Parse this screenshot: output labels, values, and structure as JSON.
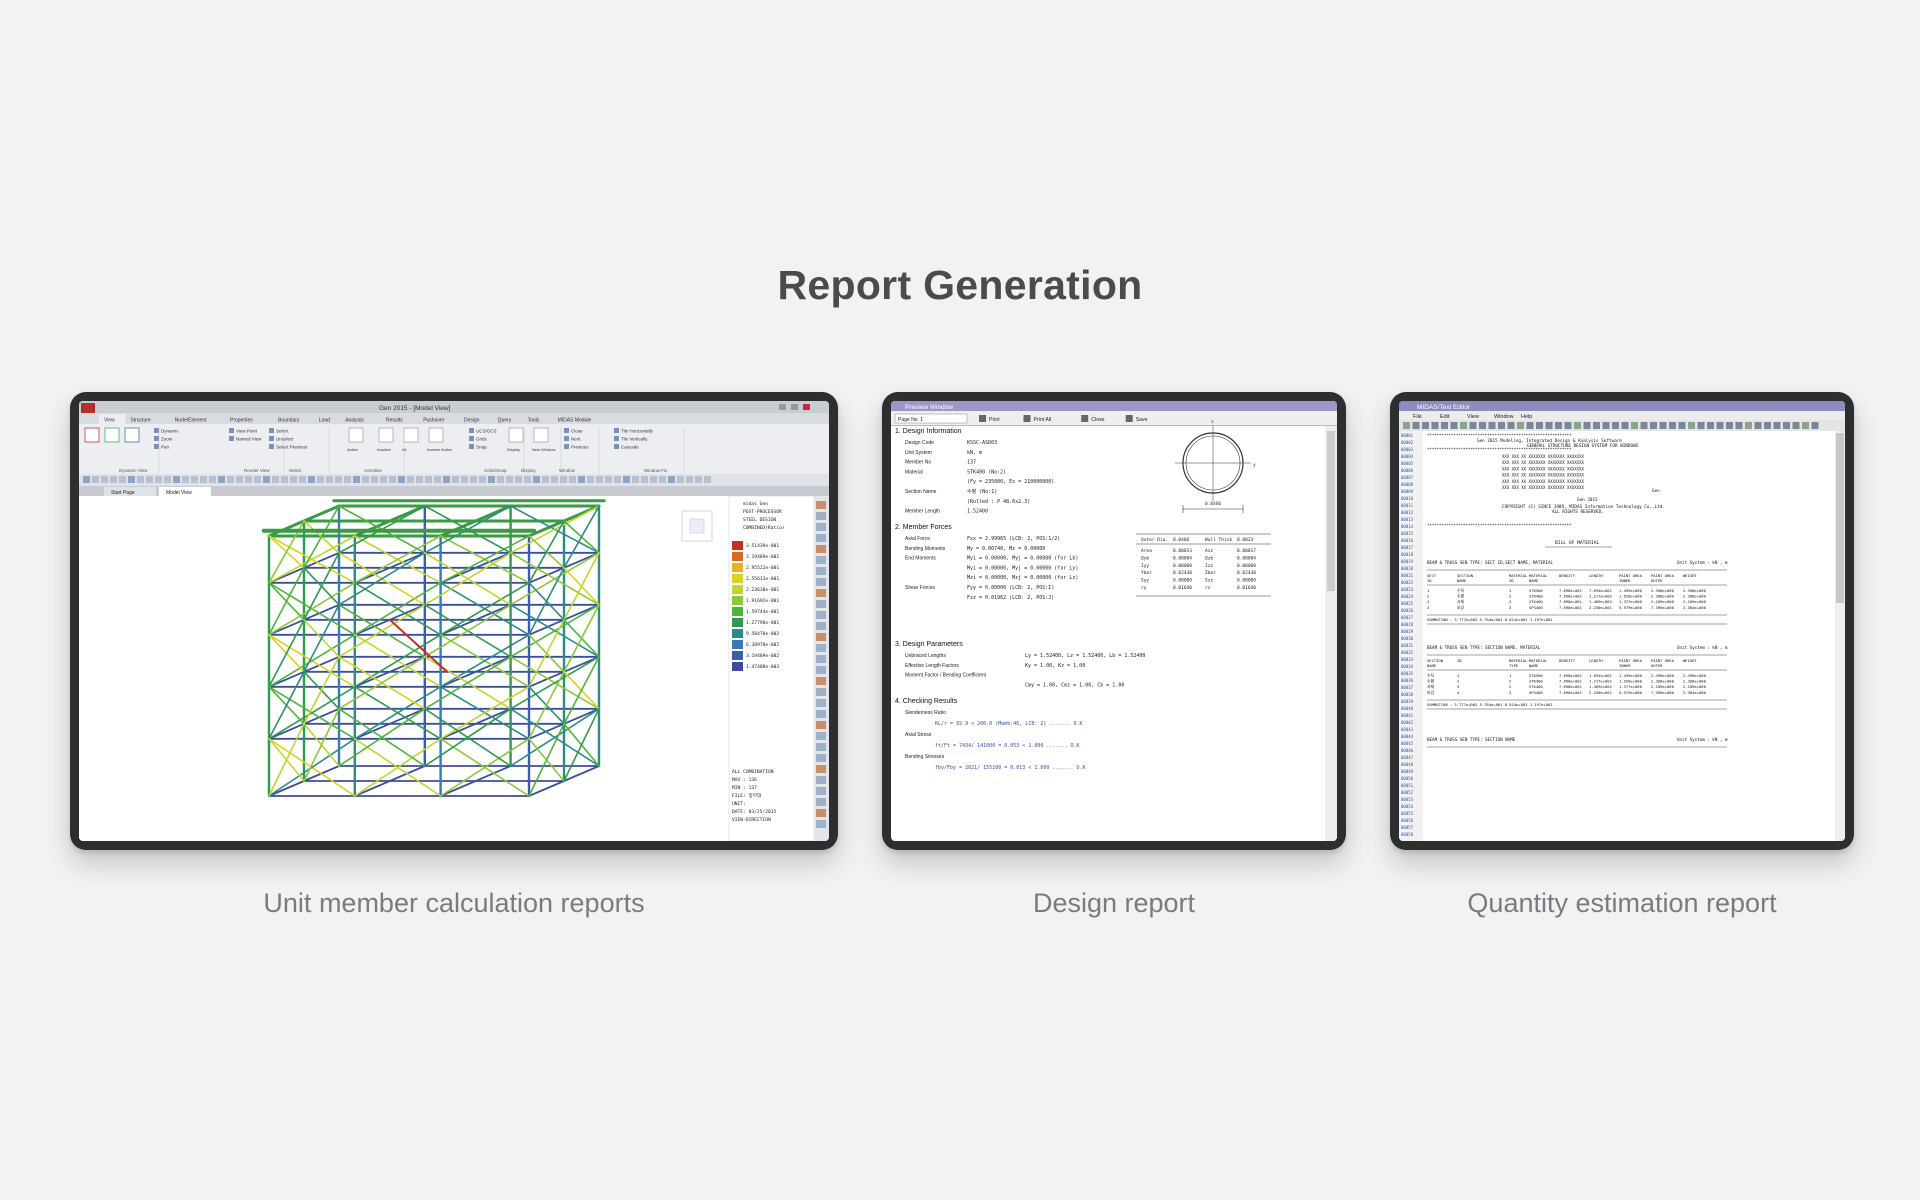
{
  "page": {
    "title": "Report Generation",
    "background": "#f1f2f4",
    "title_color": "#4a4b4d",
    "caption_color": "#7a7b7e",
    "bezel_color": "#2d2e30"
  },
  "cards": [
    {
      "caption": "Unit member calculation reports",
      "screen": {
        "window_title": "Gen 2015 - [Model View]",
        "ribbon_tabs": [
          "View",
          "Structure",
          "Node/Element",
          "Properties",
          "Boundary",
          "Load",
          "Analysis",
          "Results",
          "Pushover",
          "Design",
          "Query",
          "Tools",
          "MIDAS Module"
        ],
        "ribbon_groups": [
          "Dynamic View",
          "Render View",
          "Select",
          "Activities",
          "Grids/Snap",
          "Display",
          "Window",
          "Window Fix"
        ],
        "tool_labels": [
          "Dynamic",
          "Zoom",
          "Pan",
          "View Point",
          "Named View",
          "Select",
          "Unselect",
          "Select Previous",
          "Active",
          "Inactive",
          "All",
          "Inverse Active",
          "UCS/GCS",
          "Grids",
          "Snap",
          "Display",
          "New Window",
          "Close",
          "Next",
          "Previous",
          "Tile Horizontally",
          "Tile Vertically",
          "Cascade"
        ],
        "doc_tabs": [
          "Start Page",
          "Model View"
        ],
        "legend": {
          "header": [
            "midas Gen",
            "POST-PROCESSOR",
            "STEEL DESIGN",
            "COMBINED(Ratio)"
          ],
          "values": [
            "3.51439e-001",
            "3.19489e-001",
            "2.95522e-001",
            "2.55613e-001",
            "2.23630e-001",
            "1.91692e-001",
            "1.59744e-001",
            "1.27796e-001",
            "9.58470e-002",
            "6.38978e-002",
            "3.19489e-002",
            "1.47400e-003"
          ],
          "colors": [
            "#c33126",
            "#d9691e",
            "#e8b222",
            "#d7d320",
            "#bfd72a",
            "#8bc937",
            "#4fb43d",
            "#2e9a4f",
            "#2b8c86",
            "#3a7ab4",
            "#3d5dac",
            "#3e4a9c"
          ],
          "footer": [
            "ALL COMBINATION",
            "MAX : 136",
            "MIN : 137",
            "FILE: 동부대",
            "UNIT:",
            "DATE: 03/25/2015",
            "VIEW-DIRECTION"
          ]
        }
      }
    },
    {
      "caption": "Design report",
      "screen": {
        "window_title": "Preview Window",
        "toolbar": [
          "Page No. 1",
          "Print",
          "Print All",
          "Close",
          "Save"
        ],
        "sections": [
          {
            "heading": "1. Design Information",
            "lines": [
              [
                "Design Code",
                "KSSC-ASD03"
              ],
              [
                "Unit System",
                "kN, m"
              ],
              [
                "Member No",
                "137"
              ],
              [
                "Material",
                "STK400 (No:2)"
              ],
              [
                "",
                "(Fy = 235000, Es = 210000000)"
              ],
              [
                "Section Name",
                "수평 (No:1)"
              ],
              [
                "",
                "(Rolled : P 48.6x2.3)"
              ],
              [
                "Member Length",
                "1.52400"
              ]
            ]
          },
          {
            "heading": "2. Member Forces",
            "lines": [
              [
                "Axial Force",
                "Fxx = 2.99965  (LCB:   2,  POS:1/2)"
              ],
              [
                "Bending Moments",
                "My  = 0.00740,  Mz  = 0.00000"
              ],
              [
                "End Moments",
                "Myi = 0.00000,  Myj = 0.00000  (for Lb)"
              ],
              [
                "",
                "Myi = 0.00000,  Myj = 0.00000  (for Ly)"
              ],
              [
                "",
                "Mzi = 0.00000,  Mzj = 0.00000  (for Lz)"
              ],
              [
                "Shear Forces",
                "Fyy  = 0.00000  (LCB:   2,  POS:I)"
              ],
              [
                "",
                "Fzz  = 0.01962  (LCB:   2,  POS:J)"
              ]
            ]
          },
          {
            "heading": "3. Design Parameters",
            "lines": [
              [
                "Unbraced Lengths",
                "Ly  = 1.52400,     Lz  = 1.52400,     Lb  = 1.52400"
              ],
              [
                "Effective Length Factors",
                "Ky  =  1.00,  Kz  =  1.00"
              ],
              [
                "Moment Factor / Bending Coefficient",
                ""
              ],
              [
                "",
                "Cmy =  1.00,  Cmz =  1.00,  Cb  =  1.00"
              ]
            ]
          },
          {
            "heading": "4. Checking Results",
            "lines": [
              [
                "Slenderness Ratio",
                ""
              ],
              [
                "",
                "KL/r   =   92.9 < 200.0  (Memb:46, LCB: 2)  .......  O.K"
              ],
              [
                "Axial Stress",
                ""
              ],
              [
                "",
                "ft/Ft  =   7434/ 141000 = 0.053 < 1.000  .......  O.K"
              ],
              [
                "Bending Stresses",
                ""
              ],
              [
                "",
                "fby/Fby =   2021/ 155100 = 0.013 < 1.000  .......  O.K"
              ]
            ]
          }
        ],
        "section_table": {
          "headers": [
            "Outer Dia.",
            "0.0486",
            "Wall Thick",
            "0.0023"
          ],
          "rows": [
            [
              "Area",
              "0.00033",
              "Asz",
              "0.00017"
            ],
            [
              "Qyb",
              "0.00004",
              "Qzb",
              "0.00004"
            ],
            [
              "Iyy",
              "0.00000",
              "Izz",
              "0.00000"
            ],
            [
              "Ybar",
              "0.02430",
              "Zbar",
              "0.02430"
            ],
            [
              "Syy",
              "0.00000",
              "Szz",
              "0.00000"
            ],
            [
              "ry",
              "0.01640",
              "rz",
              "0.01640"
            ]
          ]
        },
        "dim_label": "0.0486"
      }
    },
    {
      "caption": "Quantity estimation report",
      "screen": {
        "window_title": "MIDAS/Text Editor",
        "menu": [
          "File",
          "Edit",
          "View",
          "Window",
          "Help"
        ],
        "header_lines": [
          "Gen 2015      Modeling, Integrated Design & Analysis Software",
          "GENERAL STRUCTURE DESIGN SYSTEM FOR WINDOWS",
          "COPYRIGHT (C) SINCE 1989, MIDAS Information Technology Co.,Ltd.",
          "ALL RIGHTS RESERVED."
        ],
        "bill_title": "BILL OF MATERIAL",
        "table1": {
          "title": "BEAM & TRUSS SEN TYPE:  SECT ID,SECT NAME, MATERIAL",
          "unit": "Unit System : kN , m",
          "headers": [
            "SECT ID",
            "SECTION NAME",
            "MATERIAL ID",
            "MATERIAL NAME",
            "DENSITY",
            "LENGTH",
            "PAINT AREA INNER",
            "PAINT AREA OUTER",
            "WEIGHT"
          ],
          "rows": [
            [
              "1",
              "수직",
              "1",
              "STK500",
              "7.698e+001",
              "7.694e+001",
              "1.459e+000",
              "2.398e+000",
              "2.398e+000"
            ],
            [
              "2",
              "수평",
              "2",
              "STK400",
              "7.698e+001",
              "1.217e+002",
              "1.928e+000",
              "2.306e+000",
              "2.306e+000"
            ],
            [
              "3",
              "사재",
              "2",
              "STK400",
              "7.698e+001",
              "1.469e+002",
              "1.377e+000",
              "2.109e+000",
              "2.109e+000"
            ],
            [
              "4",
              "보강",
              "3",
              "SPS400",
              "7.698e+001",
              "2.250e+001",
              "5.979e+000",
              "7.396e+000",
              "2.384e+000"
            ]
          ],
          "summation": "SUMMATION :          3.777e+002  5.784e+001  8.014e+001  1.197e+001"
        },
        "table2": {
          "title": "BEAM & TRUSS SEN TYPE:  SECTION NAME, MATERIAL",
          "unit": "Unit System : kN , m",
          "headers": [
            "SECTION NAME",
            "ID",
            "MATERIAL TYPE",
            "MATERIAL NAME",
            "DENSITY",
            "LENGTH",
            "PAINT AREA INNER",
            "PAINT AREA OUTER",
            "WEIGHT"
          ],
          "rows": [
            [
              "수직",
              "1",
              "1",
              "STK500",
              "7.698e+001",
              "1.694e+001",
              "1.459e+000",
              "2.398e+000",
              "2.398e+000"
            ],
            [
              "수평",
              "2",
              "2",
              "STK400",
              "7.698e+001",
              "1.217e+002",
              "1.928e+000",
              "2.306e+000",
              "2.306e+000"
            ],
            [
              "사재",
              "3",
              "2",
              "STK400",
              "7.698e+001",
              "1.469e+002",
              "1.377e+000",
              "2.109e+000",
              "2.109e+000"
            ],
            [
              "보강",
              "4",
              "3",
              "SPS400",
              "7.698e+001",
              "2.250e+001",
              "5.979e+000",
              "7.396e+000",
              "2.384e+000"
            ]
          ],
          "summation": "SUMMATION :          3.777e+002  5.784e+001  8.014e+001  1.197e+001"
        },
        "table3_title": "BEAM & TRUSS SEN TYPE:  SECTION NAME",
        "table3_unit": "Unit System : kN , m",
        "gen_tag": "Gen"
      }
    }
  ]
}
